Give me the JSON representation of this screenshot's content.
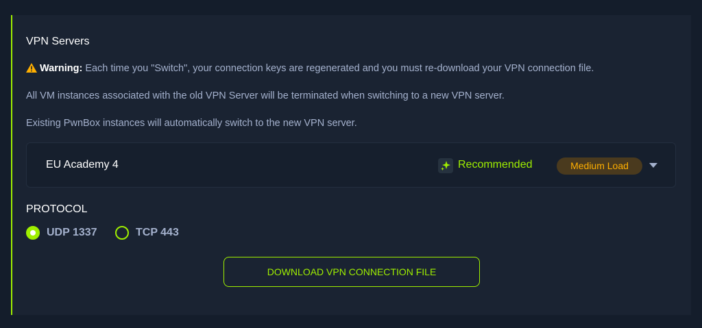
{
  "panel": {
    "title": "VPN Servers",
    "warning_label": "Warning:",
    "warning_text": " Each time you \"Switch\", your connection keys are regenerated and you must re-download your VPN connection file.",
    "line2": "All VM instances associated with the old VPN Server will be terminated when switching to a new VPN server.",
    "line3": "Existing PwnBox instances will automatically switch to the new VPN server."
  },
  "server": {
    "name": "EU Academy 4",
    "recommended_label": "Recommended",
    "load": "Medium Load"
  },
  "protocol": {
    "label": "PROTOCOL",
    "options": [
      {
        "label": "UDP 1337",
        "selected": true
      },
      {
        "label": "TCP 443",
        "selected": false
      }
    ]
  },
  "download_button": "DOWNLOAD VPN CONNECTION FILE",
  "colors": {
    "accent": "#9fef00",
    "warning": "#ffaf00",
    "background": "#141d2b",
    "panel": "#1a2332",
    "muted_text": "#a4b1cd"
  }
}
